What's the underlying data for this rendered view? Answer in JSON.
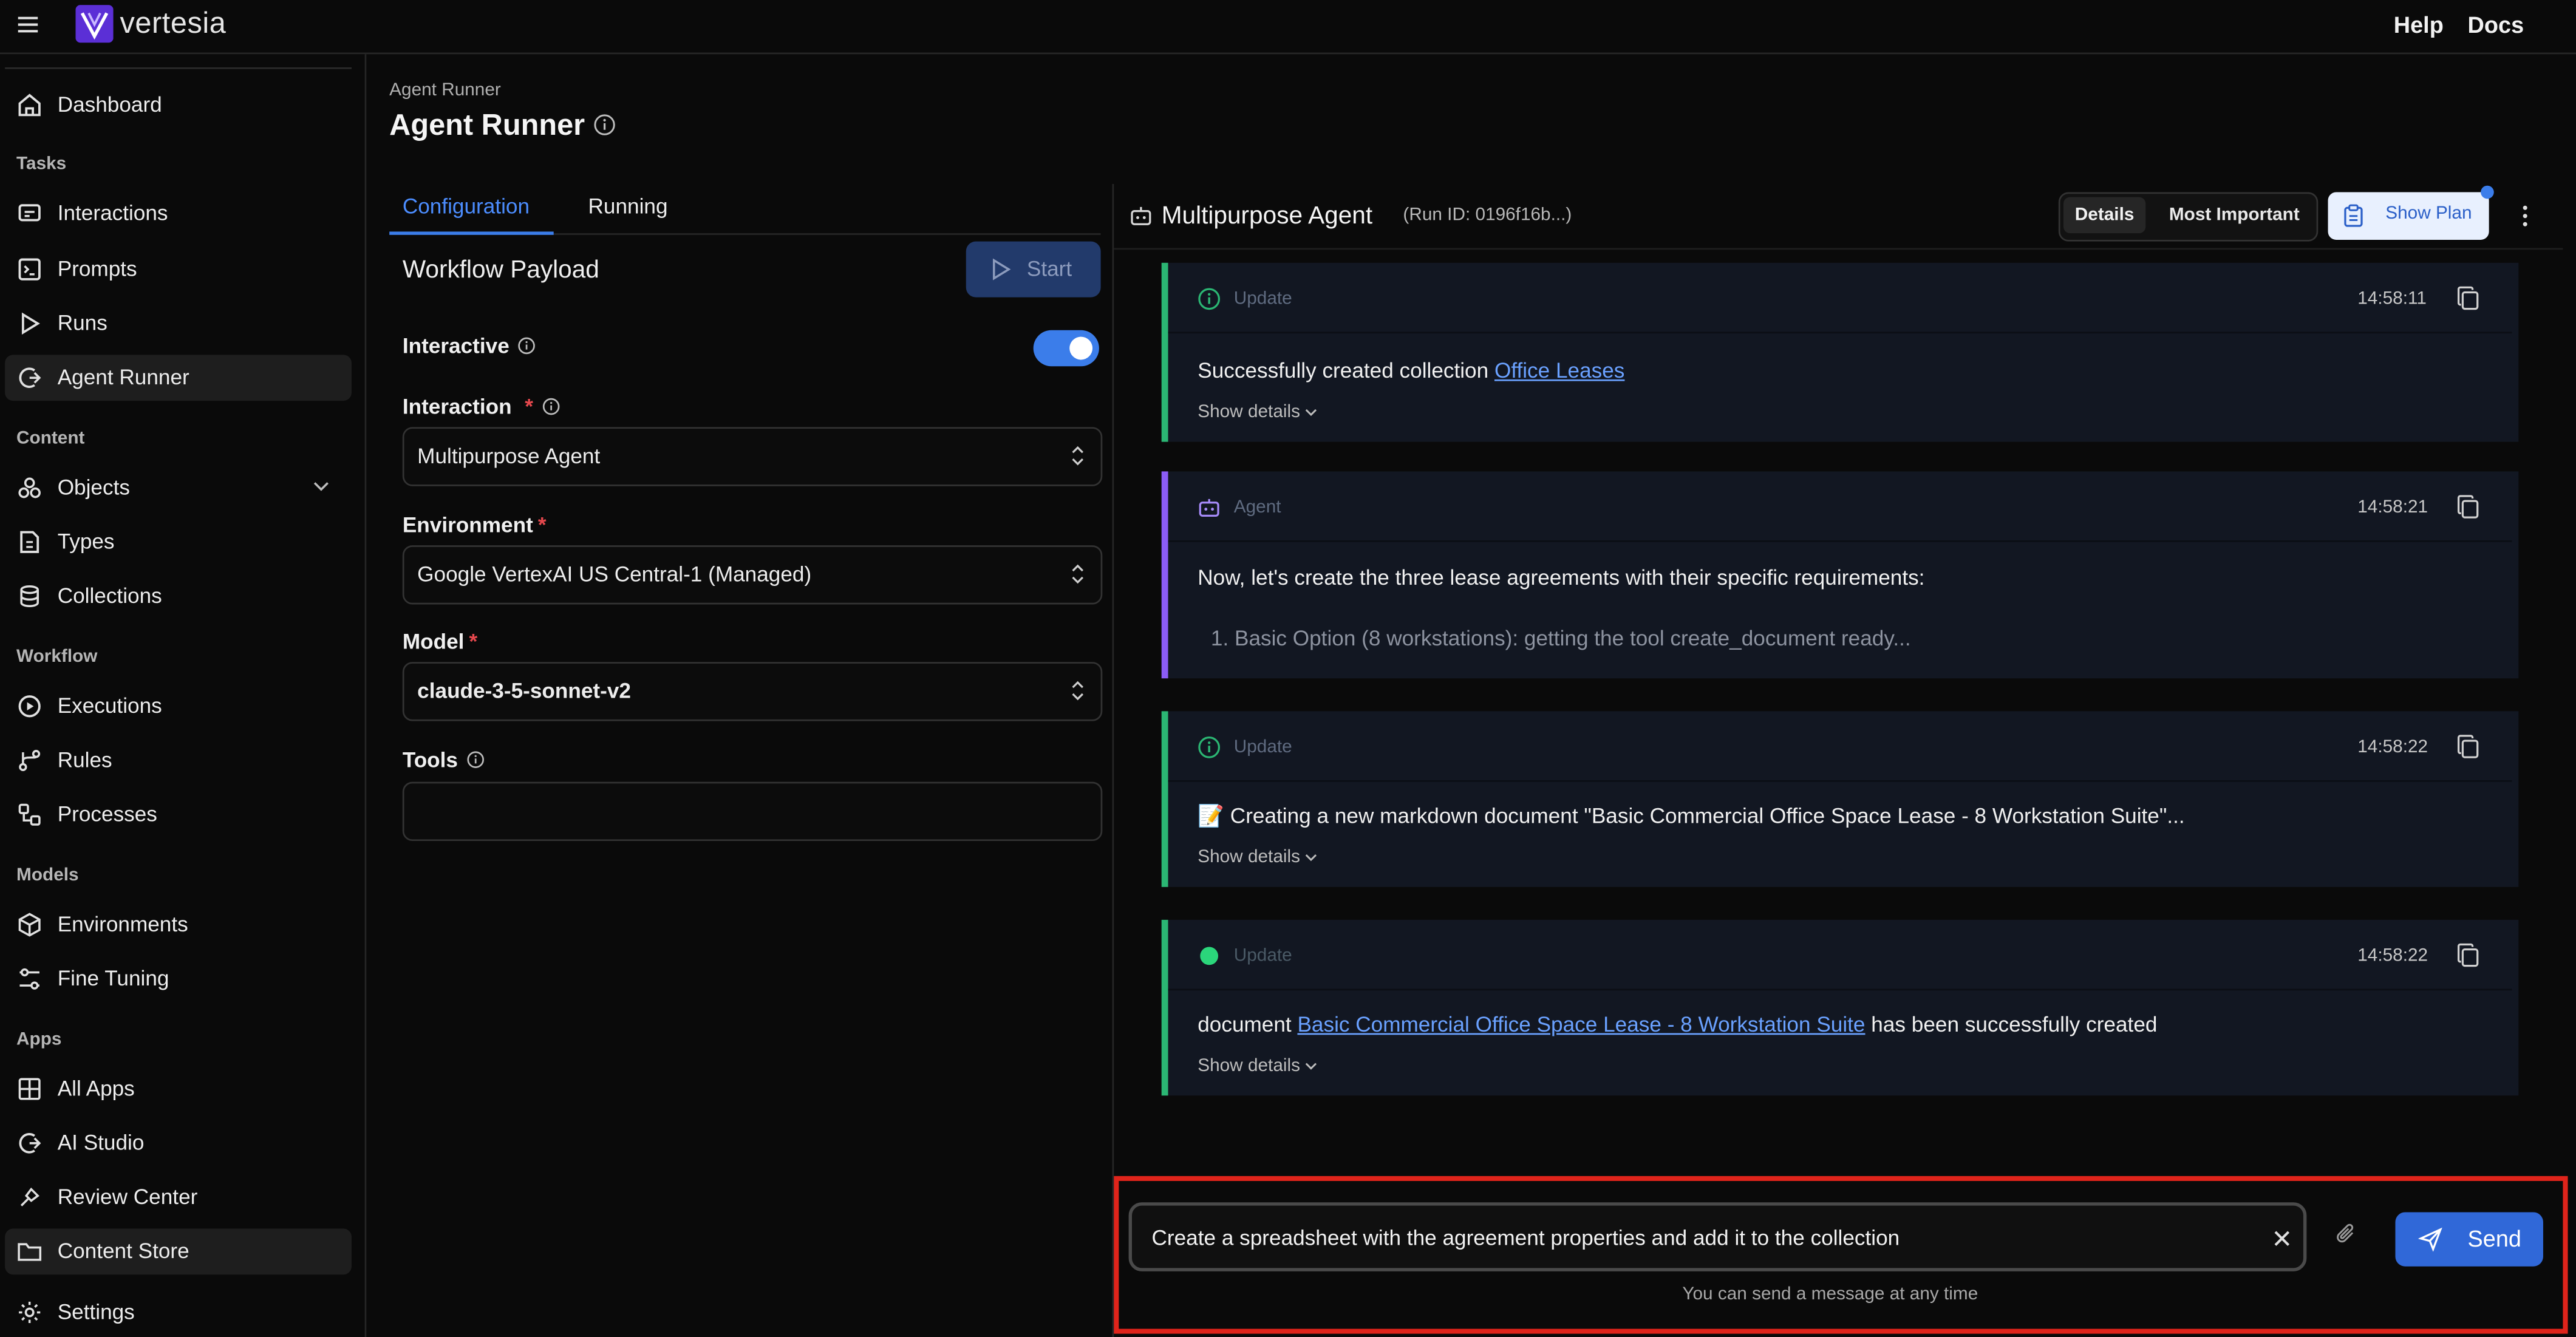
{
  "brand": {
    "name": "vertesia"
  },
  "top_links": [
    "Help",
    "Docs"
  ],
  "sidebar": {
    "dashboard": "Dashboard",
    "sections": [
      {
        "title": "Tasks",
        "items": [
          {
            "label": "Interactions",
            "icon": "interactions-icon"
          },
          {
            "label": "Prompts",
            "icon": "prompt-icon"
          },
          {
            "label": "Runs",
            "icon": "play-icon"
          },
          {
            "label": "Agent Runner",
            "icon": "agent-runner-icon",
            "active": true
          }
        ]
      },
      {
        "title": "Content",
        "items": [
          {
            "label": "Objects",
            "icon": "objects-icon",
            "expandable": true
          },
          {
            "label": "Types",
            "icon": "types-icon"
          },
          {
            "label": "Collections",
            "icon": "database-icon"
          }
        ]
      },
      {
        "title": "Workflow",
        "items": [
          {
            "label": "Executions",
            "icon": "executions-icon"
          },
          {
            "label": "Rules",
            "icon": "rules-icon"
          },
          {
            "label": "Processes",
            "icon": "processes-icon"
          }
        ]
      },
      {
        "title": "Models",
        "items": [
          {
            "label": "Environments",
            "icon": "cube-icon"
          },
          {
            "label": "Fine Tuning",
            "icon": "sliders-icon"
          }
        ]
      },
      {
        "title": "Apps",
        "items": [
          {
            "label": "All Apps",
            "icon": "apps-icon"
          },
          {
            "label": "AI Studio",
            "icon": "ai-studio-icon"
          },
          {
            "label": "Review Center",
            "icon": "review-icon"
          },
          {
            "label": "Content Store",
            "icon": "folder-icon",
            "active": true
          }
        ]
      }
    ],
    "settings": "Settings"
  },
  "page": {
    "breadcrumb": "Agent Runner",
    "title": "Agent Runner",
    "tabs": [
      "Configuration",
      "Running"
    ],
    "active_tab": "Configuration"
  },
  "config": {
    "payload_title": "Workflow Payload",
    "start_label": "Start",
    "interactive_label": "Interactive",
    "interactive": true,
    "interaction_label": "Interaction",
    "interaction_value": "Multipurpose Agent",
    "environment_label": "Environment",
    "environment_value": "Google VertexAI US Central-1 (Managed)",
    "model_label": "Model",
    "model_value": "claude-3-5-sonnet-v2",
    "tools_label": "Tools",
    "tools_value": ""
  },
  "run": {
    "agent_name": "Multipurpose Agent",
    "run_id": "(Run ID: 0196f16b...)",
    "filter_details": "Details",
    "filter_important": "Most Important",
    "show_plan": "Show Plan"
  },
  "messages": [
    {
      "kind": "Update",
      "time": "14:58:11",
      "text": "Successfully created collection ",
      "link": "Office Leases",
      "details": "Show details"
    },
    {
      "kind": "Agent",
      "time": "14:58:21",
      "text": "Now, let's create the three lease agreements with their specific requirements:",
      "step": "1.   Basic Option (8 workstations): getting the tool create_document ready..."
    },
    {
      "kind": "Update",
      "time": "14:58:22",
      "text": "📝 Creating a new markdown document \"Basic Commercial Office Space Lease - 8 Workstation Suite\"...",
      "details": "Show details"
    },
    {
      "kind": "Update",
      "time": "14:58:22",
      "text_pre": "document ",
      "link": "Basic Commercial Office Space Lease - 8 Workstation Suite",
      "text_post": " has been successfully created",
      "details": "Show details"
    }
  ],
  "composer": {
    "value": "Create a spreadsheet with the agreement properties and add it to the collection",
    "send_label": "Send",
    "hint": "You can send a message at any time"
  },
  "colors": {
    "accent": "#3b7dea",
    "update_border": "#2bb673",
    "agent_border": "#8b5cf6",
    "highlight_frame": "#e0241b",
    "required": "#e5484d"
  }
}
